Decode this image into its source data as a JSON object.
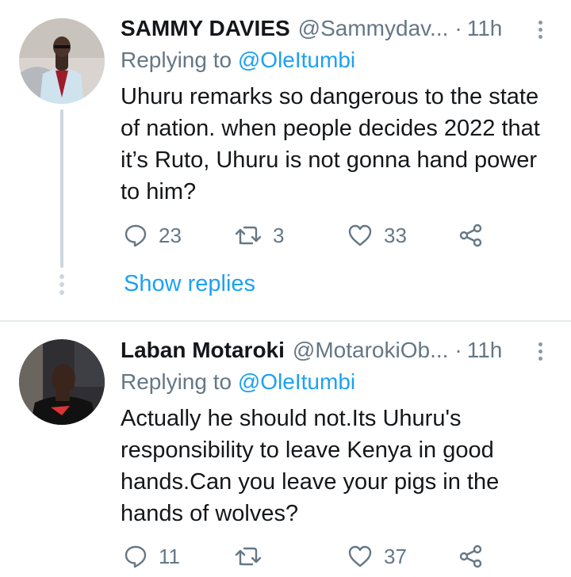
{
  "tweets": [
    {
      "name": "SAMMY DAVIES",
      "handle": "@Sammydav...",
      "separator": "·",
      "time": "11h",
      "replying_prefix": "Replying to",
      "replying_to": "@OleItumbi",
      "text": "Uhuru remarks so dangerous to the state of nation. when people decides 2022 that it’s Ruto, Uhuru is not gonna hand power to him?",
      "replies": "23",
      "retweets": "3",
      "likes": "33",
      "show_replies": "Show replies"
    },
    {
      "name": "Laban Motaroki",
      "handle": "@MotarokiOb...",
      "separator": "·",
      "time": "11h",
      "replying_prefix": "Replying to",
      "replying_to": "@OleItumbi",
      "text": "Actually he should not.Its Uhuru's responsibility to leave Kenya in good hands.Can you leave your pigs in the hands of wolves?",
      "replies": "11",
      "retweets": "",
      "likes": "37"
    }
  ],
  "icons": {
    "reply": "speech-bubble-icon",
    "retweet": "retweet-icon",
    "like": "heart-icon",
    "share": "share-icon",
    "more": "vertical-dots-icon"
  },
  "colors": {
    "link": "#1da1f2",
    "secondary_text": "#657786",
    "primary_text": "#14171a",
    "thread_line": "#ccd6dd",
    "divider": "#e6ecf0"
  }
}
